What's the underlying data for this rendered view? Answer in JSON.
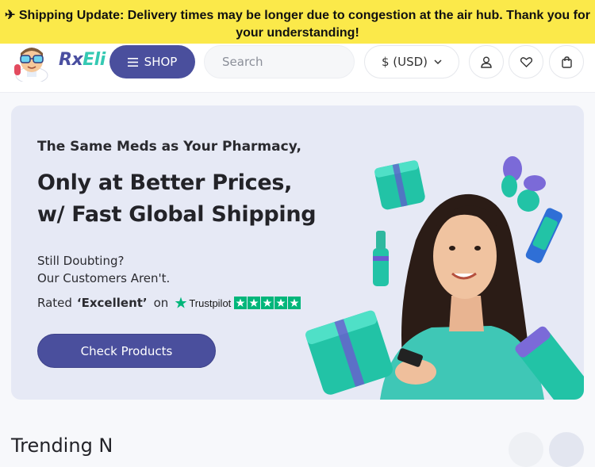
{
  "announcement": {
    "icon": "airplane-icon",
    "text": "✈ Shipping Update: Delivery times may be longer due to congestion at the air hub. Thank you for your understanding!"
  },
  "header": {
    "logo": {
      "prefix": "Rx",
      "suffix": "Eli"
    },
    "shop_label": "SHOP",
    "search_placeholder": "Search",
    "currency_label": "$ (USD)",
    "icons": [
      "user-icon",
      "heart-icon",
      "bag-icon"
    ]
  },
  "hero": {
    "subtitle": "The Same Meds as Your Pharmacy,",
    "title_line1": "Only at Better Prices,",
    "title_line2": "w/ Fast Global Shipping",
    "doubt_line1": "Still Doubting?",
    "doubt_line2": "Our Customers Aren't.",
    "rated_prefix": "Rated",
    "rated_value": "‘Excellent’",
    "rated_on": "on",
    "trustpilot_label": "Trustpilot",
    "trustpilot_stars": 5,
    "cta_label": "Check Products"
  },
  "section": {
    "title_partial": "Trending N"
  },
  "colors": {
    "banner": "#fbe94a",
    "brand": "#4a4f9d",
    "teal": "#35c9b3",
    "trustpilot": "#00b67a",
    "hero_bg": "#e6e9f5"
  }
}
